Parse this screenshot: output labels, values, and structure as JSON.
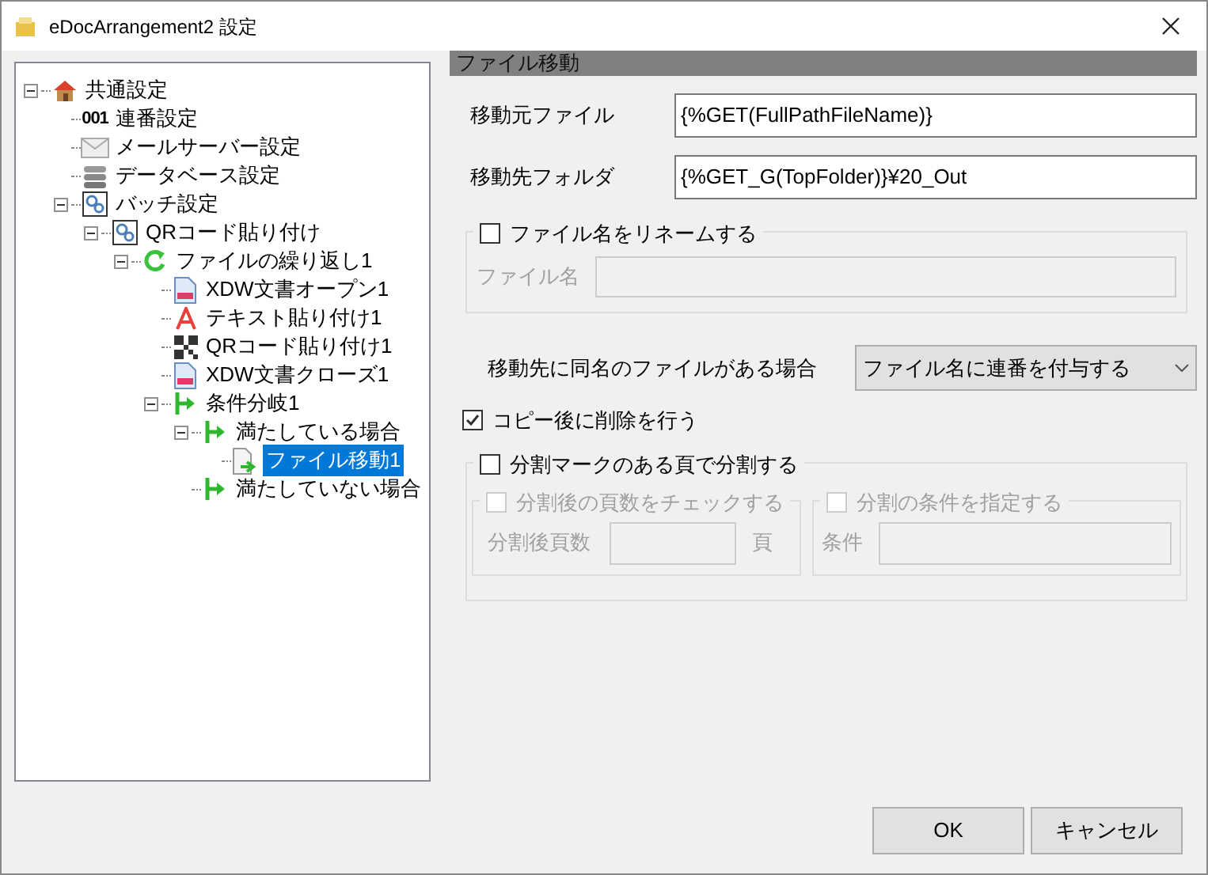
{
  "window": {
    "title": "eDocArrangement2 設定"
  },
  "tree": [
    {
      "label": "共通設定",
      "kind": "house",
      "expanded": true,
      "selected": false,
      "children": [
        {
          "label": "連番設定",
          "kind": "number",
          "prefix": "001",
          "selected": false
        },
        {
          "label": "メールサーバー設定",
          "kind": "mail",
          "selected": false
        },
        {
          "label": "データベース設定",
          "kind": "database",
          "selected": false
        },
        {
          "label": "バッチ設定",
          "kind": "gears",
          "expanded": true,
          "selected": false,
          "children": [
            {
              "label": "QRコード貼り付け",
              "kind": "gears",
              "expanded": true,
              "selected": false,
              "children": [
                {
                  "label": "ファイルの繰り返し1",
                  "kind": "loop",
                  "expanded": true,
                  "selected": false,
                  "children": [
                    {
                      "label": "XDW文書オープン1",
                      "kind": "doc",
                      "selected": false
                    },
                    {
                      "label": "テキスト貼り付け1",
                      "kind": "letter",
                      "selected": false
                    },
                    {
                      "label": "QRコード貼り付け1",
                      "kind": "qr",
                      "selected": false
                    },
                    {
                      "label": "XDW文書クローズ1",
                      "kind": "doc",
                      "selected": false
                    },
                    {
                      "label": "条件分岐1",
                      "kind": "branch",
                      "expanded": true,
                      "selected": false,
                      "children": [
                        {
                          "label": "満たしている場合",
                          "kind": "branch",
                          "expanded": true,
                          "selected": false,
                          "children": [
                            {
                              "label": "ファイル移動1",
                              "kind": "move",
                              "selected": true
                            }
                          ]
                        },
                        {
                          "label": "満たしていない場合",
                          "kind": "branch",
                          "selected": false
                        }
                      ]
                    }
                  ]
                }
              ]
            }
          ]
        }
      ]
    }
  ],
  "panel": {
    "title": "ファイル移動",
    "fields": [
      {
        "label": "移動元ファイル",
        "value": "{%GET(FullPathFileName)}"
      },
      {
        "label": "移動先フォルダ",
        "value": "{%GET_G(TopFolder)}¥20_Out"
      }
    ],
    "rename": {
      "label": "ファイル名をリネームする",
      "checked": false,
      "field_label": "ファイル名",
      "disabled": true
    },
    "conflict": {
      "label": "移動先に同名のファイルがある場合",
      "value": "ファイル名に連番を付与する"
    },
    "delete_after": {
      "label": "コピー後に削除を行う",
      "checked": true
    },
    "split": {
      "label": "分割マークのある頁で分割する",
      "checked": false,
      "page_check": {
        "label": "分割後の頁数をチェックする",
        "checked": false,
        "disabled": true,
        "field_label": "分割後頁数",
        "unit": "頁"
      },
      "condition": {
        "label": "分割の条件を指定する",
        "checked": false,
        "disabled": true,
        "field_label": "条件"
      }
    }
  },
  "buttons": [
    {
      "label": "OK"
    },
    {
      "label": "キャンセル"
    }
  ]
}
